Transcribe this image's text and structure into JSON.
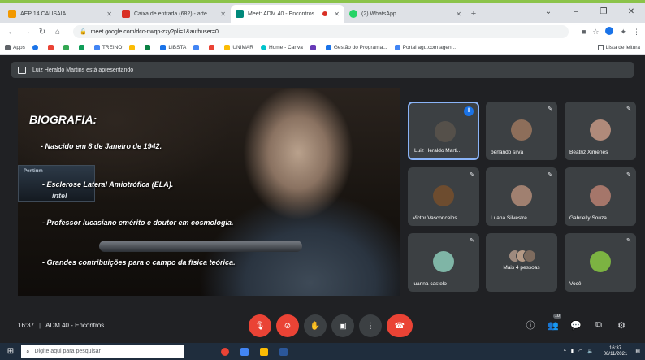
{
  "colors": {
    "accent": "#8bc34a",
    "meet_bg": "#202124",
    "tile_bg": "#3c4043",
    "speaking_border": "#8ab4f8",
    "danger": "#ea4335"
  },
  "browser": {
    "tabs": [
      {
        "title": "AEP 14 CAUSAIA",
        "favicon_color": "#f29900",
        "active": false
      },
      {
        "title": "Caixa de entrada (682) - arte.ad...",
        "favicon_color": "#d93025",
        "active": false
      },
      {
        "title": "Meet: ADM 40 - Encontros",
        "favicon_color": "#00897b",
        "active": true,
        "recording": true
      },
      {
        "title": "(2) WhatsApp",
        "favicon_color": "#25d366",
        "active": false
      }
    ],
    "new_tab_icon": "plus-icon",
    "window_controls": [
      "minimize-icon",
      "maximize-icon",
      "close-icon"
    ],
    "url": "meet.google.com/dcc-nwqp-zzy?pli=1&authuser=0",
    "bookmarks": [
      {
        "label": "Apps",
        "color": "#5f6368"
      },
      {
        "label": "",
        "color": "#1a73e8"
      },
      {
        "label": "",
        "color": "#ea4335"
      },
      {
        "label": "",
        "color": "#34a853"
      },
      {
        "label": "",
        "color": "#0f9d58"
      },
      {
        "label": "TREINO",
        "color": "#4285f4"
      },
      {
        "label": "",
        "color": "#fbbc04"
      },
      {
        "label": "",
        "color": "#0b8043"
      },
      {
        "label": "LIBSTA",
        "color": "#1a73e8"
      },
      {
        "label": "",
        "color": "#4285f4"
      },
      {
        "label": "",
        "color": "#ea4335"
      },
      {
        "label": "UNIMAR",
        "color": "#fbbc04"
      },
      {
        "label": "Home - Canva",
        "color": "#00c4cc"
      },
      {
        "label": "",
        "color": "#673ab7"
      },
      {
        "label": "Gestão do Programa...",
        "color": "#1a73e8"
      },
      {
        "label": "Portal agu.com agen...",
        "color": "#4285f4"
      }
    ],
    "reading_list_label": "Lista de leitura"
  },
  "presenting_banner": "Luiz Heraldo Martins está apresentando",
  "slide": {
    "title": "BIOGRAFIA:",
    "monitor_label": "Pentium",
    "intel_label": "intel",
    "bullets": [
      "-  Nascido em 8 de Janeiro de 1942.",
      "-  Esclerose Lateral Amiotrófica (ELA).",
      "-  Professor lucasiano emérito e doutor em cosmologia.",
      "-  Grandes contribuições para o campo da física teórica."
    ]
  },
  "participants": [
    {
      "name": "Luiz Heraldo Marti...",
      "avatar_color": "#55504a",
      "speaking": true
    },
    {
      "name": "berlando silva",
      "avatar_color": "#8d6e5a",
      "speaking": false
    },
    {
      "name": "Beatriz Ximenes",
      "avatar_color": "#b08a7a",
      "speaking": false
    },
    {
      "name": "Victor Vasconcelos",
      "avatar_color": "#6d4c2f",
      "speaking": false
    },
    {
      "name": "Luana Silvestre",
      "avatar_color": "#a08070",
      "speaking": false
    },
    {
      "name": "Gabrielly Souza",
      "avatar_color": "#a5766a",
      "speaking": false
    },
    {
      "name": "luanna castelo",
      "avatar_color": "#7fb5a6",
      "speaking": false
    },
    {
      "name": "Mais 4 pessoas",
      "avatar_color": "#9e8a7e",
      "speaking": false
    },
    {
      "name": "Você",
      "avatar_color": "#7cb342",
      "speaking": false
    }
  ],
  "meeting": {
    "time": "16:37",
    "name": "ADM 40 - Encontros"
  },
  "people_count": "10",
  "taskbar": {
    "search_placeholder": "Digite aqui para pesquisar",
    "clock_time": "16:37",
    "clock_date": "08/11/2021"
  }
}
